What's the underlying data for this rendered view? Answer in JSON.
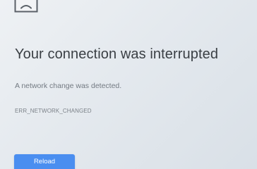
{
  "error_page": {
    "icon": "sad-document-icon",
    "title": "Your connection was interrupted",
    "message": "A network change was detected.",
    "error_code": "ERR_NETWORK_CHANGED",
    "reload_label": "Reload"
  },
  "colors": {
    "button_background": "#4a8ef0",
    "title_text": "#3a3f44",
    "body_text": "#737a82"
  }
}
